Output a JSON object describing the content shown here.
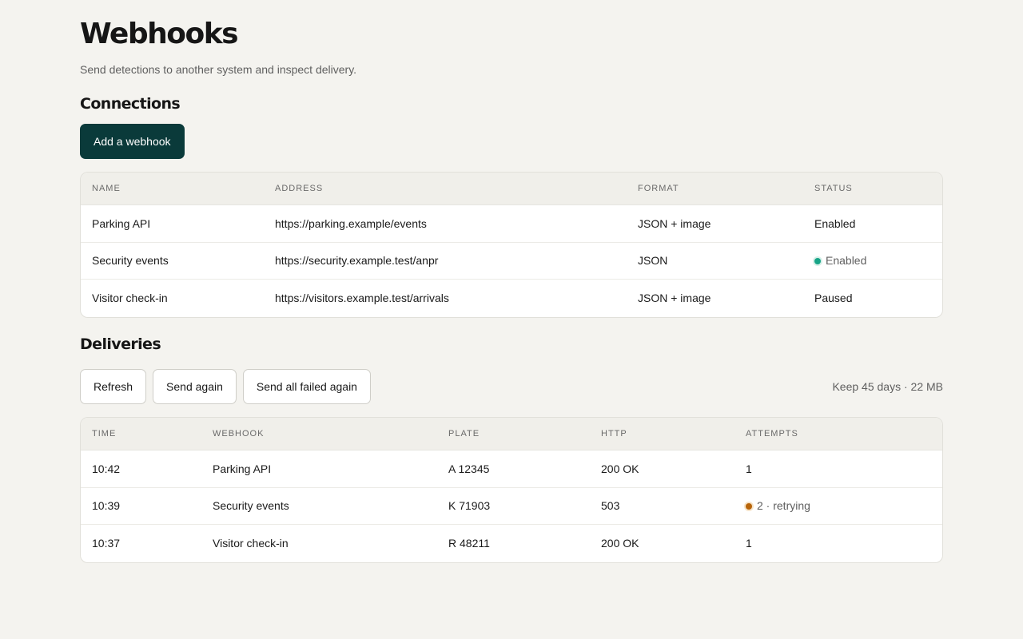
{
  "header": {
    "title": "Webhooks",
    "subtitle": "Send detections to another system and inspect delivery."
  },
  "connections": {
    "section_title": "Connections",
    "add_button": "Add a webhook",
    "columns": [
      "NAME",
      "ADDRESS",
      "FORMAT",
      "STATUS"
    ],
    "rows": [
      {
        "name": "Parking API",
        "address": "https://parking.example/events",
        "format": "JSON + image",
        "status": "Enabled"
      },
      {
        "name": "Security events",
        "address": "https://security.example.test/anpr",
        "format": "JSON",
        "status": "Enabled"
      },
      {
        "name": "Visitor check-in",
        "address": "https://visitors.example.test/arrivals",
        "format": "JSON + image",
        "status": "Paused"
      }
    ]
  },
  "deliveries": {
    "section_title": "Deliveries",
    "buttons": {
      "refresh": "Refresh",
      "send_again": "Send again",
      "send_all_failed": "Send all failed again"
    },
    "retention": "Keep 45 days · 22 MB",
    "columns": [
      "TIME",
      "WEBHOOK",
      "PLATE",
      "HTTP",
      "ATTEMPTS"
    ],
    "rows": [
      {
        "time": "10:42",
        "webhook": "Parking API",
        "plate": "A 12345",
        "http": "200 OK",
        "attempts": "1"
      },
      {
        "time": "10:39",
        "webhook": "Security events",
        "plate": "K 71903",
        "http": "503",
        "attempts": "2 · retrying"
      },
      {
        "time": "10:37",
        "webhook": "Visitor check-in",
        "plate": "R 48211",
        "http": "200 OK",
        "attempts": "1"
      }
    ]
  },
  "colors": {
    "primary": "#0a3a3a",
    "enabled_dot": "#17a487",
    "retrying_dot": "#b8650a"
  }
}
